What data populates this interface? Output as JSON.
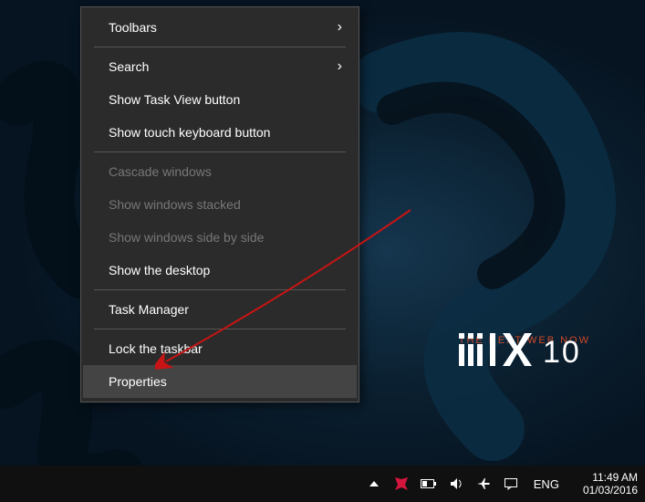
{
  "logo": {
    "tagline": "THE NEXT WEB NOW"
  },
  "context_menu": {
    "items": [
      {
        "label": "Toolbars",
        "submenu": true,
        "enabled": true
      },
      {
        "sep": true
      },
      {
        "label": "Search",
        "submenu": true,
        "enabled": true
      },
      {
        "label": "Show Task View button",
        "enabled": true
      },
      {
        "label": "Show touch keyboard button",
        "enabled": true
      },
      {
        "sep": true
      },
      {
        "label": "Cascade windows",
        "enabled": false
      },
      {
        "label": "Show windows stacked",
        "enabled": false
      },
      {
        "label": "Show windows side by side",
        "enabled": false
      },
      {
        "label": "Show the desktop",
        "enabled": true
      },
      {
        "sep": true
      },
      {
        "label": "Task Manager",
        "enabled": true
      },
      {
        "sep": true
      },
      {
        "label": "Lock the taskbar",
        "enabled": true
      },
      {
        "label": "Properties",
        "enabled": true,
        "hovered": true
      }
    ]
  },
  "taskbar": {
    "language": "ENG",
    "time": "11:49 AM",
    "date": "01/03/2016"
  }
}
